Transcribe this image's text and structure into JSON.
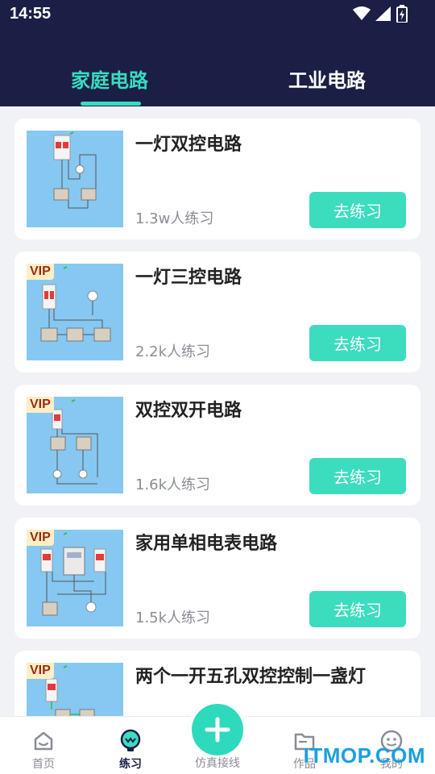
{
  "status": {
    "time": "14:55"
  },
  "tabs": [
    {
      "label": "家庭电路",
      "active": true
    },
    {
      "label": "工业电路",
      "active": false
    }
  ],
  "cards": [
    {
      "title": "一灯双控电路",
      "count": "1.3w人练习",
      "button": "去练习",
      "vip": ""
    },
    {
      "title": "一灯三控电路",
      "count": "2.2k人练习",
      "button": "去练习",
      "vip": "VIP"
    },
    {
      "title": "双控双开电路",
      "count": "1.6k人练习",
      "button": "去练习",
      "vip": "VIP"
    },
    {
      "title": "家用单相电表电路",
      "count": "1.5k人练习",
      "button": "去练习",
      "vip": "VIP"
    },
    {
      "title": "两个一开五孔双控控制一盏灯",
      "count": "",
      "button": "",
      "vip": "VIP"
    }
  ],
  "bottom_nav": [
    {
      "label": "首页",
      "icon": "home-icon"
    },
    {
      "label": "练习",
      "icon": "bulb-icon",
      "active": true
    },
    {
      "label": "仿真接线",
      "icon": "plus-icon"
    },
    {
      "label": "作品",
      "icon": "folder-icon"
    },
    {
      "label": "我的",
      "icon": "profile-icon"
    }
  ],
  "watermark": "ITMOP.COM",
  "colors": {
    "header": "#1b1f45",
    "accent": "#3cdcbf",
    "card_bg": "#ffffff",
    "page_bg": "#f1f2f6"
  }
}
